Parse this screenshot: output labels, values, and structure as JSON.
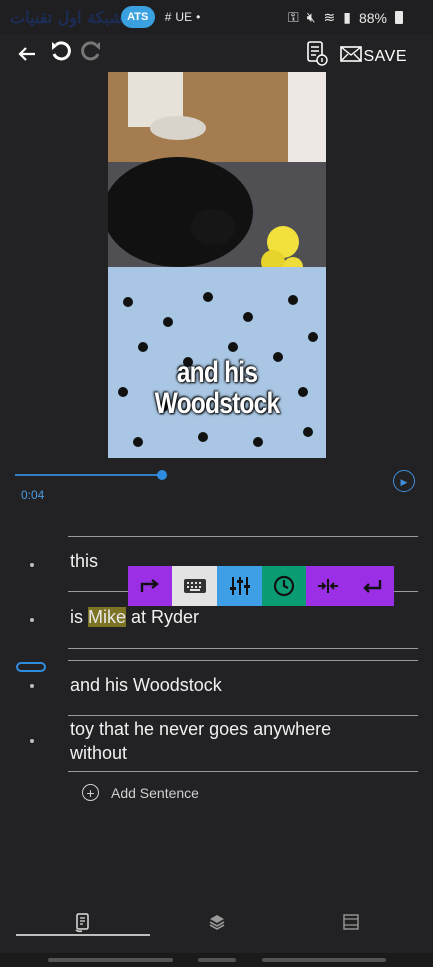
{
  "status_bar": {
    "watermark_text": "شبكة اول تقنيات",
    "watermark_badge": "ATS",
    "carrier": "UE",
    "battery": "88%"
  },
  "toolbar": {
    "back_icon": "arrow-left-icon",
    "undo_icon": "undo-icon",
    "redo_icon": "redo-icon",
    "info_icon": "script-info-icon",
    "mail_icon": "mail-icon",
    "save_label": "SAVE"
  },
  "video": {
    "caption_line1": "and his",
    "caption_line2": "Woodstock",
    "current_time": "0:04",
    "progress": 0.35
  },
  "sentences": [
    {
      "text": "this"
    },
    {
      "pre": "is ",
      "highlight": "Mike",
      "post": " at Ryder"
    },
    {
      "text": "and his Woodstock"
    },
    {
      "text": "toy that he never goes anywhere without"
    }
  ],
  "floating_toolbar": {
    "buttons": [
      {
        "icon": "redirect-arrow-icon",
        "color": "#9b2fe6"
      },
      {
        "icon": "keyboard-icon",
        "color": "#e3e3e3"
      },
      {
        "icon": "sliders-icon",
        "color": "#3e9fe6"
      },
      {
        "icon": "clock-icon",
        "color": "#0c9c73"
      },
      {
        "icon": "split-icon",
        "color": "#9b2fe6"
      },
      {
        "icon": "enter-icon",
        "color": "#9b2fe6"
      }
    ]
  },
  "add_sentence_label": "Add Sentence",
  "bottom_nav": [
    {
      "icon": "script-icon",
      "selected": true
    },
    {
      "icon": "layers-icon",
      "selected": false
    },
    {
      "icon": "layout-icon",
      "selected": false
    }
  ]
}
